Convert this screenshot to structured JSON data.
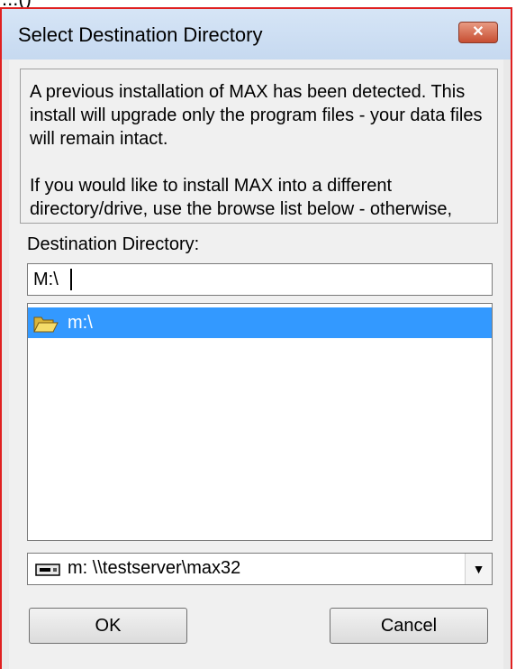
{
  "fragment": "...()",
  "window": {
    "title": "Select Destination Directory",
    "close_glyph": "✕"
  },
  "info": {
    "paragraph1": "A previous installation of MAX has been detected. This install will upgrade only the program files - your data files will remain intact.",
    "paragraph2": "If you would like to install MAX into a different directory/drive, use the browse list below - otherwise,"
  },
  "destination": {
    "label": "Destination Directory:",
    "value": "M:\\"
  },
  "directory_list": {
    "items": [
      {
        "name": "m:\\",
        "icon": "open-folder-icon",
        "selected": true
      }
    ]
  },
  "drive": {
    "icon": "network-drive-icon",
    "selected": "m:  \\\\testserver\\max32",
    "arrow": "▼"
  },
  "buttons": {
    "ok": "OK",
    "cancel": "Cancel"
  },
  "colors": {
    "selection": "#3399ff",
    "window_border": "#e02020",
    "close_button": "#c74e32"
  }
}
